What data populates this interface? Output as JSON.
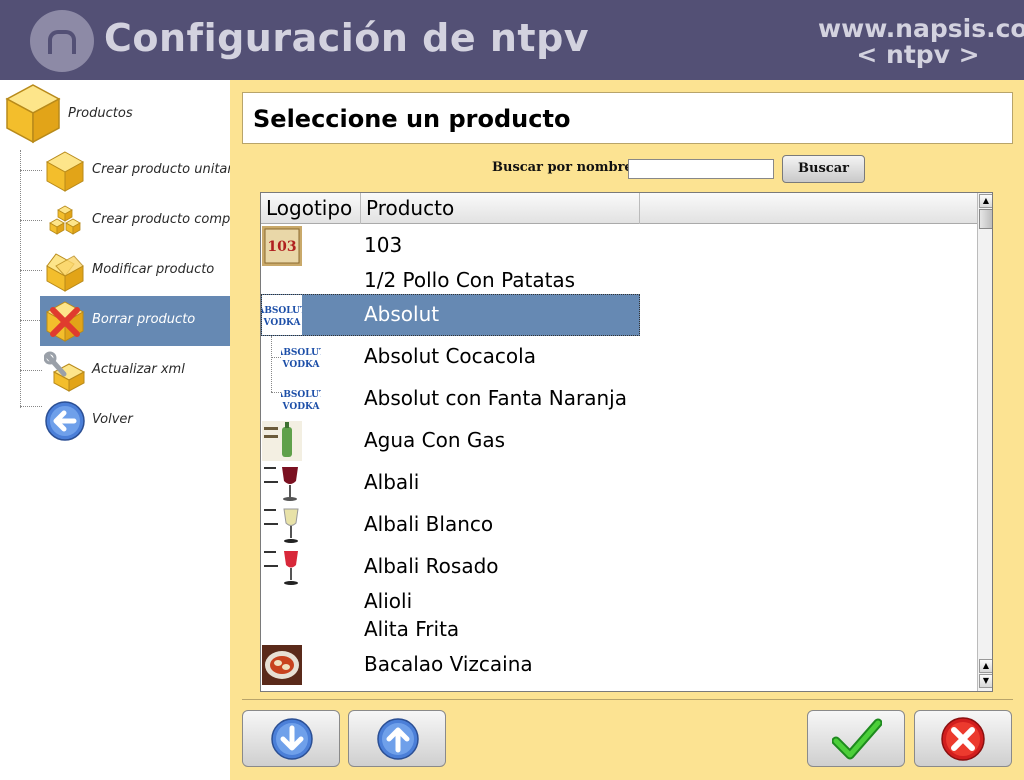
{
  "header": {
    "title": "Configuración de ntpv",
    "site_url": "www.napsis.com",
    "app_tag": "< ntpv >"
  },
  "sidebar": {
    "root_label": "Productos",
    "items": [
      {
        "label": "Crear producto unitario",
        "icon": "cube-icon"
      },
      {
        "label": "Crear producto compuesto",
        "icon": "cubes-icon"
      },
      {
        "label": "Modificar producto",
        "icon": "open-box-icon"
      },
      {
        "label": "Borrar producto",
        "icon": "delete-cube-icon",
        "selected": true
      },
      {
        "label": "Actualizar xml",
        "icon": "wrench-cube-icon"
      },
      {
        "label": "Volver",
        "icon": "back-arrow-icon"
      }
    ]
  },
  "main": {
    "title": "Seleccione un producto",
    "search": {
      "label": "Buscar por nombre",
      "value": "",
      "button_label": "Buscar"
    },
    "table": {
      "columns": [
        "Logotipo",
        "Producto",
        ""
      ],
      "rows": [
        {
          "name": "103",
          "logo": "brandy-103-logo"
        },
        {
          "name": "1/2 Pollo Con Patatas",
          "logo": ""
        },
        {
          "name": "Absolut",
          "logo": "absolut-vodka-logo",
          "selected": true
        },
        {
          "name": "Absolut Cocacola",
          "logo": "absolut-vodka-logo",
          "child": true
        },
        {
          "name": "Absolut con Fanta Naranja",
          "logo": "absolut-vodka-logo",
          "child": true
        },
        {
          "name": "Agua Con Gas",
          "logo": "water-bottle-logo"
        },
        {
          "name": "Albali",
          "logo": "red-wine-glass-logo"
        },
        {
          "name": "Albali Blanco",
          "logo": "white-wine-glass-logo"
        },
        {
          "name": "Albali Rosado",
          "logo": "rose-wine-glass-logo"
        },
        {
          "name": "Alioli",
          "logo": ""
        },
        {
          "name": "Alita Frita",
          "logo": ""
        },
        {
          "name": "Bacalao Vizcaina",
          "logo": "cod-dish-logo"
        }
      ]
    }
  },
  "footer": {
    "buttons": [
      {
        "name": "scroll-down-button",
        "icon": "down-arrow-icon"
      },
      {
        "name": "scroll-up-button",
        "icon": "up-arrow-icon"
      },
      {
        "name": "accept-button",
        "icon": "checkmark-icon"
      },
      {
        "name": "cancel-button",
        "icon": "cancel-x-icon"
      }
    ]
  },
  "colors": {
    "header_bg": "#535075",
    "header_text": "#d3d2df",
    "main_bg": "#fce392",
    "selection": "#6689b3"
  }
}
